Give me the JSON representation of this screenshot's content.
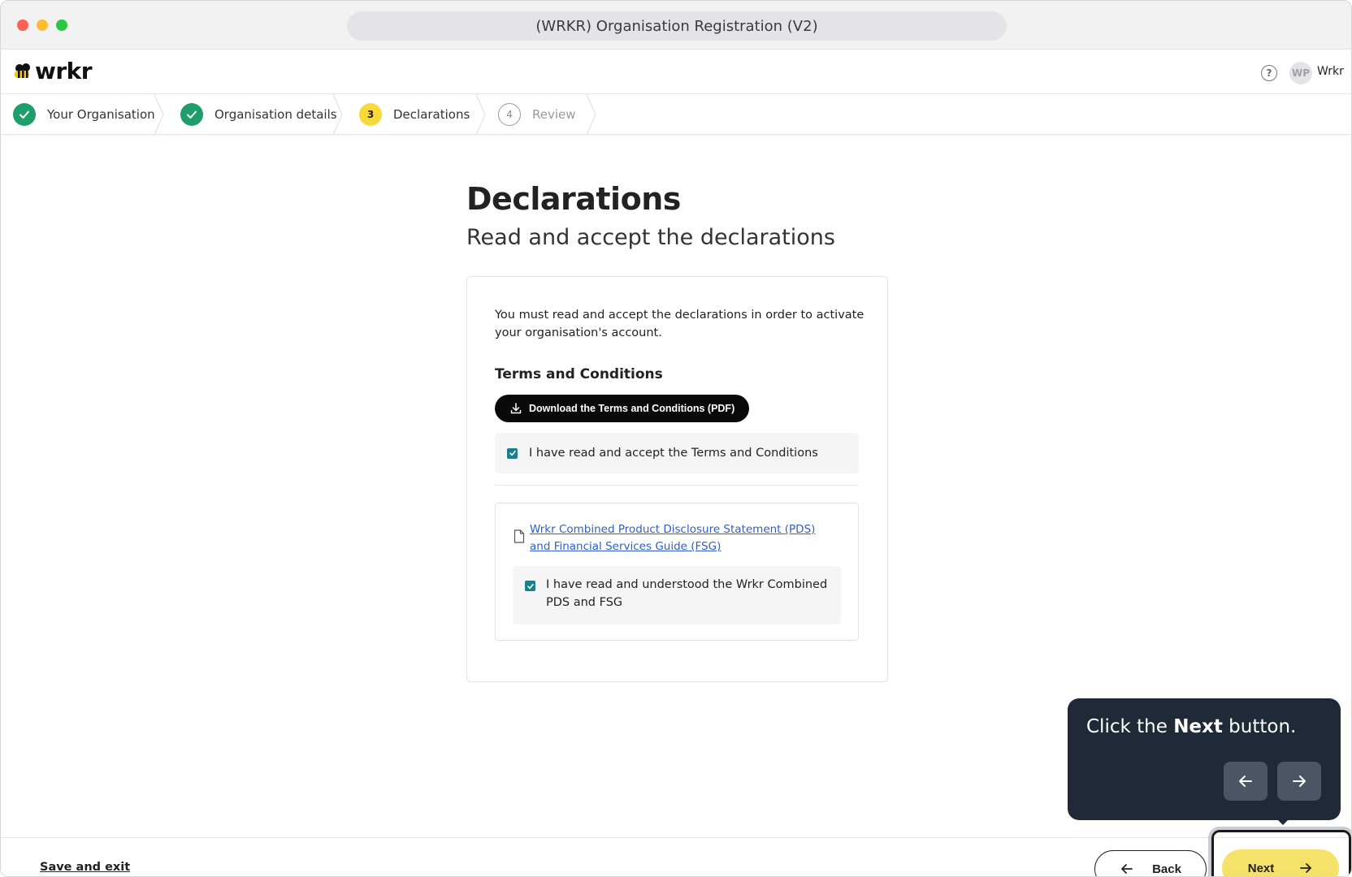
{
  "window": {
    "title": "(WRKR) Organisation Registration (V2)"
  },
  "header": {
    "logo_text": "wrkr",
    "user_initials": "WP",
    "user_name": "Wrkr",
    "help_glyph": "?"
  },
  "stepper": {
    "steps": [
      {
        "label": "Your Organisation",
        "state": "done"
      },
      {
        "label": "Organisation details",
        "state": "done"
      },
      {
        "label": "Declarations",
        "state": "current",
        "number": "3"
      },
      {
        "label": "Review",
        "state": "todo",
        "number": "4"
      }
    ]
  },
  "main": {
    "title": "Declarations",
    "subtitle": "Read and accept the declarations",
    "intro": "You must read and accept the declarations in order to activate your organisation's account.",
    "terms_heading": "Terms and Conditions",
    "download_label": "Download the Terms and Conditions (PDF)",
    "terms_checkbox_label": "I have read and accept the Terms and Conditions",
    "terms_checked": true,
    "pds_link": "Wrkr Combined Product Disclosure Statement (PDS) and Financial Services Guide (FSG)",
    "pds_checkbox_label": "I have read and understood the Wrkr Combined PDS and FSG",
    "pds_checked": true
  },
  "tooltip": {
    "prefix": "Click the ",
    "bold": "Next",
    "suffix": " button."
  },
  "footer": {
    "save_exit": "Save and exit",
    "back": "Back",
    "next": "Next"
  },
  "colors": {
    "accent_yellow": "#f5e26a",
    "done_green": "#1f9d6b",
    "current_yellow": "#f8d93a",
    "tooltip_bg": "#1f2937",
    "link_blue": "#2f5dc9"
  }
}
